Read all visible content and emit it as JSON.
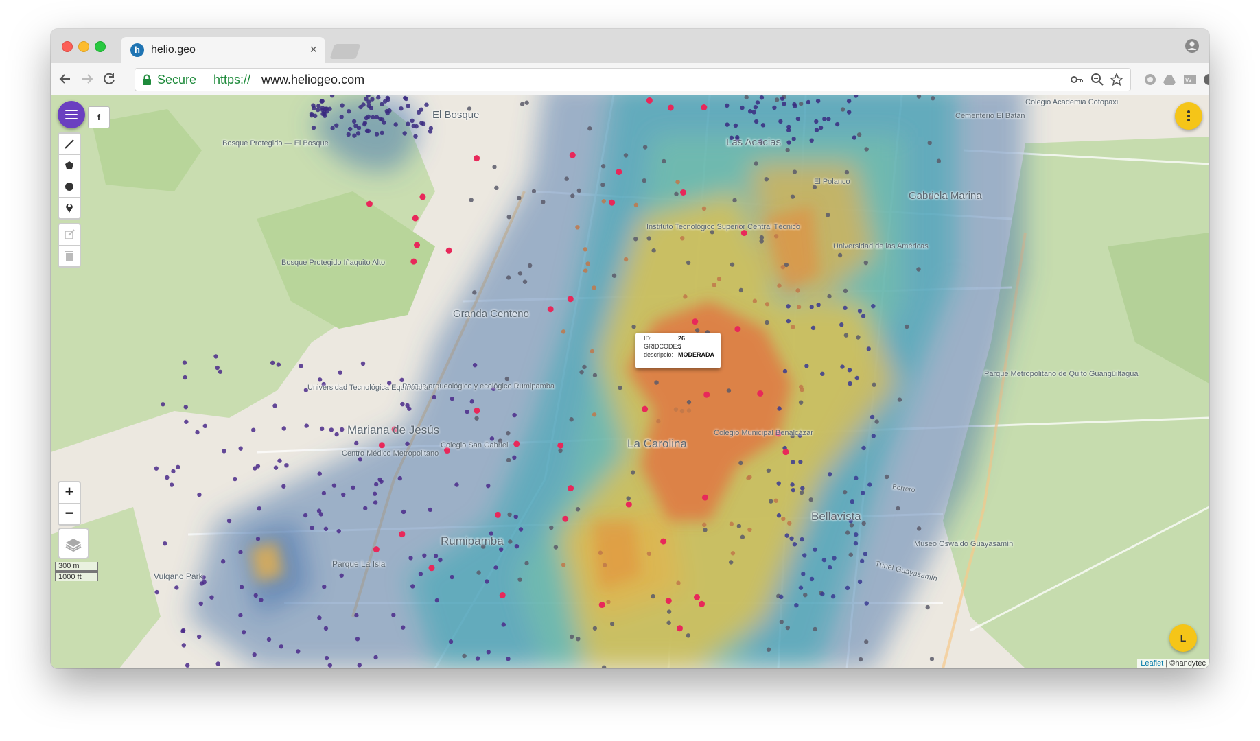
{
  "browser": {
    "tab_title": "helio.geo",
    "tab_close": "×",
    "favicon_letter": "h",
    "secure_label": "Secure",
    "url_scheme": "https://",
    "url_host": "www.heliogeo.com"
  },
  "map": {
    "fb_button": "f",
    "zoom_in": "+",
    "zoom_out": "−",
    "l_button": "L",
    "scale_metric": "300 m",
    "scale_imperial": "1000 ft",
    "attribution_leaflet": "Leaflet",
    "attribution_rest": " | ©handytec",
    "places": [
      "El Bosque",
      "Bosque Protegido — El Bosque",
      "Bosque Protegido Iñaquito Alto",
      "Las Acacias",
      "El Polanco",
      "Gabriela Marina",
      "Colegio Academia Cotopaxi",
      "Cementerio El Batán",
      "Instituto Tecnológico Superior Central Técnico",
      "Universidad de las Américas",
      "Granda Centeno",
      "Universidad Tecnológica Equinoccial",
      "Parque arqueológico y ecológico Rumipamba",
      "Mariana de Jesús",
      "Centro Médico Metropolitano",
      "Colegio San Gabriel",
      "La Carolina",
      "Colegio Municipal Benalcázar",
      "Parque Metropolitano de Quito Guangüiltagua",
      "Bellavista",
      "Museo Oswaldo Guayasamín",
      "Rumipamba",
      "Parque La Isla",
      "Vulqano Park",
      "Túnel Guayasamín",
      "Borrero"
    ],
    "popup": {
      "id_label": "ID:",
      "id_value": "26",
      "gridcode_label": "GRIDCODE:",
      "gridcode_value": "5",
      "descripcio_label": "descripcio:",
      "descripcio_value": "MODERADA"
    }
  },
  "colors": {
    "menu_fab": "#6a3fc0",
    "yellow_fab": "#f5c518",
    "secure_green": "#1e8a3b"
  }
}
